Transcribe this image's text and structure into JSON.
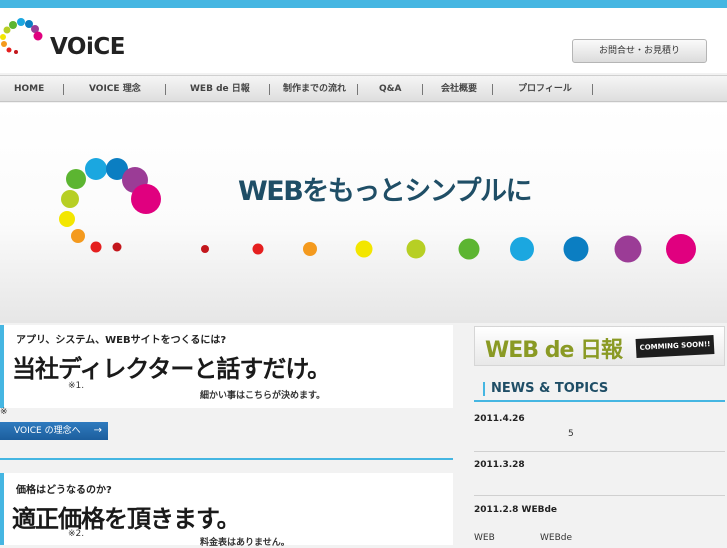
{
  "brand": {
    "logo_text": "VOiCE"
  },
  "header": {
    "contact_label": "お問合せ・お見積り"
  },
  "nav": {
    "items": [
      "HOME",
      "VOICE 理念",
      "WEB de 日報",
      "制作までの流れ",
      "Q&A",
      "会社概要",
      "プロフィール"
    ]
  },
  "hero": {
    "title": "WEBをもっとシンプルに"
  },
  "card1": {
    "sub": "アプリ、システム、WEBサイトをつくるには?",
    "main": "当社ディレクターと話すだけ。",
    "note": "※1.",
    "small": "細かい事はこちらが決めます。"
  },
  "asterisk": "※",
  "concept_button": {
    "label": "VOICE の理念へ",
    "arrow": "→"
  },
  "card2": {
    "sub": "価格はどうなるのか?",
    "main": "適正価格を頂きます。",
    "note": "※2.",
    "small": "料金表はありません。"
  },
  "side": {
    "webde_title": "WEB de 日報",
    "coming_soon": "COMMING SOON!!",
    "news_title": "NEWS & TOPICS",
    "news": [
      {
        "date": "2011.4.26",
        "text": "5"
      },
      {
        "date": "2011.3.28",
        "text": ""
      },
      {
        "date": "2011.2.8  WEBde",
        "text": "WEB",
        "text2": "WEBde"
      }
    ]
  },
  "colors": {
    "accent": "#45b6e2",
    "title": "#1f4e66",
    "dots": [
      "#e0007f",
      "#9b3c96",
      "#0b7ec2",
      "#1ba7e0",
      "#5cb531",
      "#b7cf24",
      "#f3e600",
      "#f49a1e",
      "#e51f1f",
      "#c3161c"
    ]
  }
}
